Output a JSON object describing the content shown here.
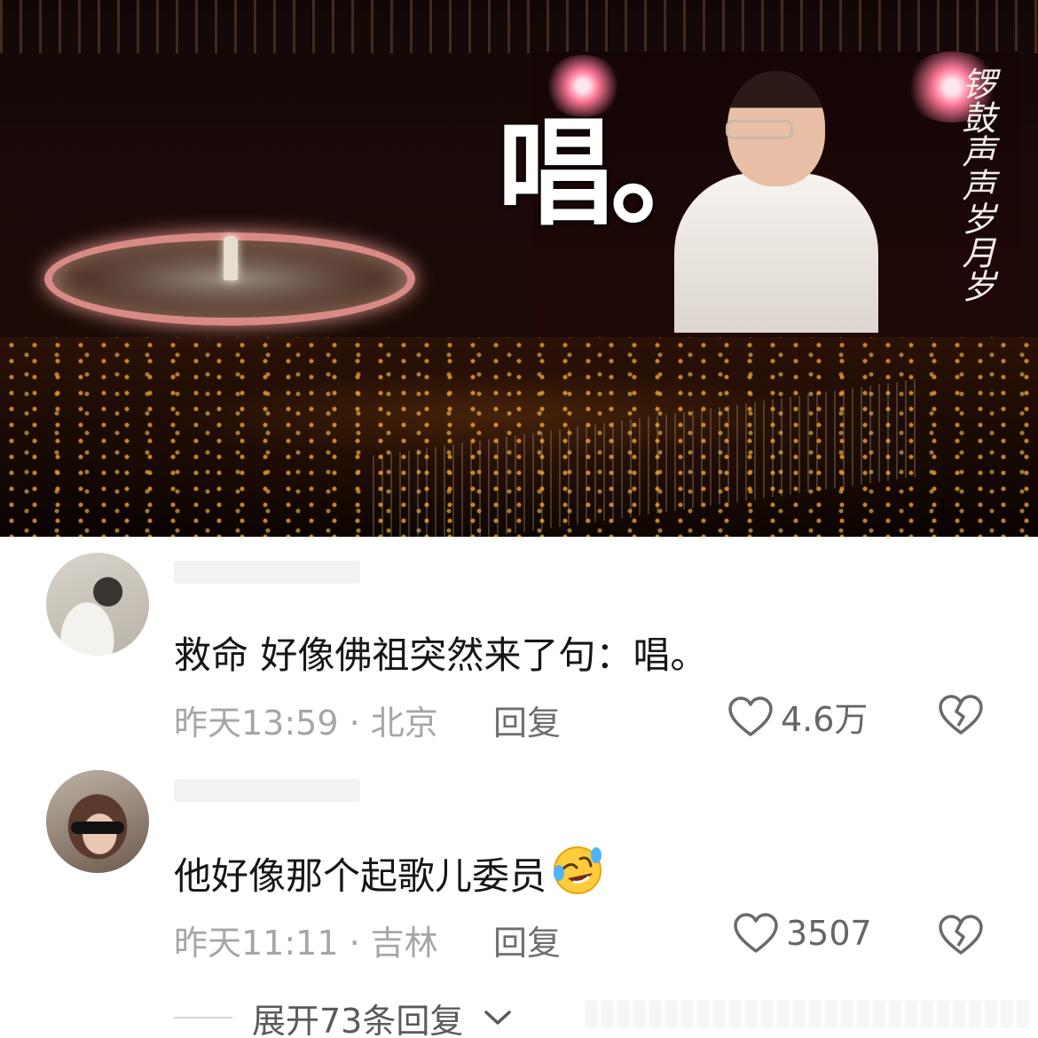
{
  "post_image": {
    "overlay_text": "唱。",
    "screen_lyric": "锣鼓声声岁月岁"
  },
  "comments": [
    {
      "text": "救命 好像佛祖突然来了句：唱。",
      "meta": "昨天13:59 · 北京",
      "reply_label": "回复",
      "likes": "4.6万",
      "emoji": ""
    },
    {
      "text": "他好像那个起歌儿委员",
      "meta": "昨天11:11 · 吉林",
      "reply_label": "回复",
      "likes": "3507",
      "emoji": "rolling-on-floor-laughing"
    }
  ],
  "expand_replies": {
    "label": "展开73条回复"
  },
  "icons": {
    "like": "heart-outline-icon",
    "dislike": "broken-heart-icon",
    "expand": "chevron-down-icon"
  }
}
